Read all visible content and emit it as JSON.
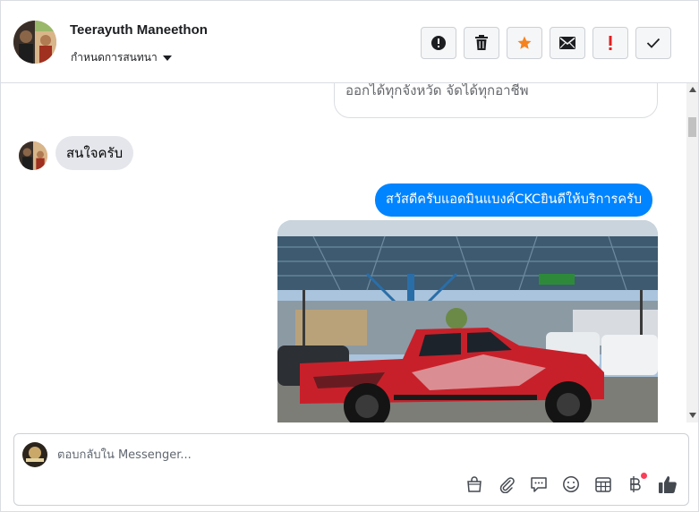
{
  "header": {
    "contact_name": "Teerayuth Maneethon",
    "conversation_settings_label": "กำหนดการสนทนา",
    "actions": [
      {
        "name": "report-spam",
        "icon": "alert-circle-icon"
      },
      {
        "name": "delete",
        "icon": "trash-icon"
      },
      {
        "name": "star",
        "icon": "star-icon",
        "color": "#f5821f"
      },
      {
        "name": "mark-unread",
        "icon": "envelope-icon"
      },
      {
        "name": "flag-important",
        "icon": "exclamation-icon",
        "color": "#e02020"
      },
      {
        "name": "mark-done",
        "icon": "checkmark-icon"
      }
    ]
  },
  "conversation": {
    "card_text": "ออกได้ทุกจังหวัด จัดได้ทุกอาชีพ",
    "incoming_message": "สนใจครับ",
    "outgoing_message": "สวัสดีครับแอดมินแบงค์CKCยินดีให้บริการครับ",
    "outgoing_color": "#0084ff",
    "incoming_color": "#e4e6eb",
    "photo": {
      "icon": "photo-red-pickup-truck"
    }
  },
  "composer": {
    "placeholder": "ตอบกลับใน Messenger...",
    "tools": [
      {
        "name": "shop",
        "icon": "shopping-bag-icon"
      },
      {
        "name": "attach",
        "icon": "paperclip-icon"
      },
      {
        "name": "saved-replies",
        "icon": "chat-bubble-icon"
      },
      {
        "name": "emoji",
        "icon": "smiley-icon"
      },
      {
        "name": "appointment",
        "icon": "calendar-icon"
      },
      {
        "name": "payment",
        "icon": "baht-icon",
        "notification": true
      },
      {
        "name": "like",
        "icon": "thumbs-up-icon"
      }
    ]
  }
}
